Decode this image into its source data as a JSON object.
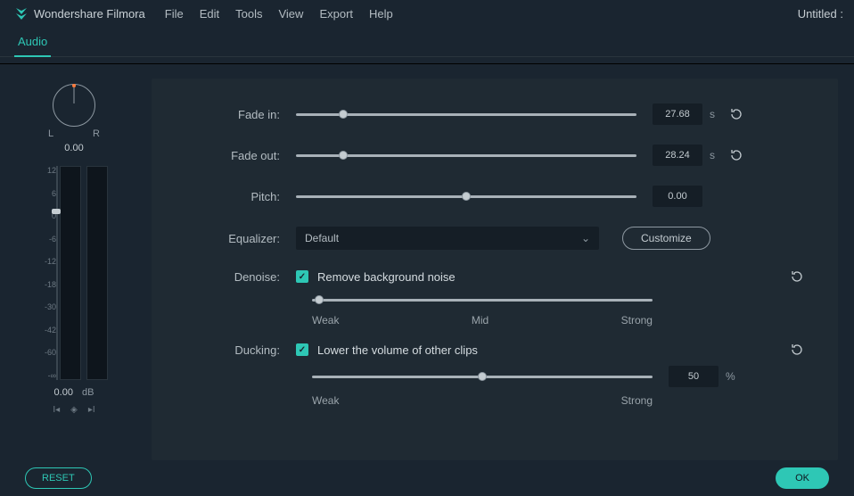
{
  "app_name": "Wondershare Filmora",
  "document_name": "Untitled :",
  "menus": [
    "File",
    "Edit",
    "Tools",
    "View",
    "Export",
    "Help"
  ],
  "active_tab": "Audio",
  "pan": {
    "left_label": "L",
    "right_label": "R",
    "value": "0.00"
  },
  "meter": {
    "scale": [
      "12",
      "6",
      "0",
      "-6",
      "-12",
      "-18",
      "-30",
      "-42",
      "-60",
      "-∞"
    ],
    "db_value": "0.00",
    "db_unit": "dB"
  },
  "fade_in": {
    "label": "Fade in:",
    "value": "27.68",
    "unit": "s",
    "pos_pct": 14
  },
  "fade_out": {
    "label": "Fade out:",
    "value": "28.24",
    "unit": "s",
    "pos_pct": 14
  },
  "pitch": {
    "label": "Pitch:",
    "value": "0.00",
    "pos_pct": 50
  },
  "equalizer": {
    "label": "Equalizer:",
    "selected": "Default",
    "customize": "Customize"
  },
  "denoise": {
    "label": "Denoise:",
    "checkbox_label": "Remove background noise",
    "pos_pct": 2,
    "legend": [
      "Weak",
      "Mid",
      "Strong"
    ]
  },
  "ducking": {
    "label": "Ducking:",
    "checkbox_label": "Lower the volume of other clips",
    "value": "50",
    "unit": "%",
    "pos_pct": 50,
    "legend": [
      "Weak",
      "Strong"
    ]
  },
  "footer": {
    "reset": "RESET",
    "ok": "OK"
  }
}
